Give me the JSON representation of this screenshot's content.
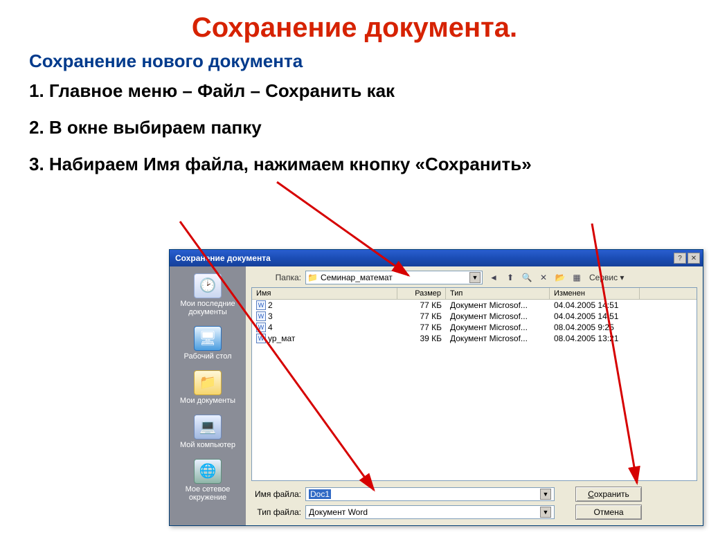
{
  "slide": {
    "title": "Сохранение документа.",
    "heading": "Сохранение нового документа",
    "step1": "1. Главное меню – Файл – Сохранить как",
    "step2": "2. В окне выбираем папку",
    "step3": "3. Набираем Имя файла, нажимаем кнопку «Сохранить»"
  },
  "dialog": {
    "title": "Сохранение документа",
    "folder_label": "Папка:",
    "folder_value": "Семинар_математ",
    "tools_label": "Сервис",
    "columns": {
      "name": "Имя",
      "size": "Размер",
      "type": "Тип",
      "modified": "Изменен"
    },
    "files": [
      {
        "name": "2",
        "size": "77 КБ",
        "type": "Документ Microsof...",
        "modified": "04.04.2005 14:51"
      },
      {
        "name": "3",
        "size": "77 КБ",
        "type": "Документ Microsof...",
        "modified": "04.04.2005 14:51"
      },
      {
        "name": "4",
        "size": "77 КБ",
        "type": "Документ Microsof...",
        "modified": "08.04.2005 9:25"
      },
      {
        "name": "ур_мат",
        "size": "39 КБ",
        "type": "Документ Microsof...",
        "modified": "08.04.2005 13:21"
      }
    ],
    "filename_label": "Имя файла:",
    "filename_value": "Doc1",
    "filetype_label": "Тип файла:",
    "filetype_value": "Документ Word",
    "save_btn": "Сохранить",
    "cancel_btn": "Отмена"
  },
  "places": {
    "recent": "Мои последние документы",
    "desktop": "Рабочий стол",
    "mydocs": "Мои документы",
    "mycomp": "Мой компьютер",
    "network": "Мое сетевое окружение"
  }
}
